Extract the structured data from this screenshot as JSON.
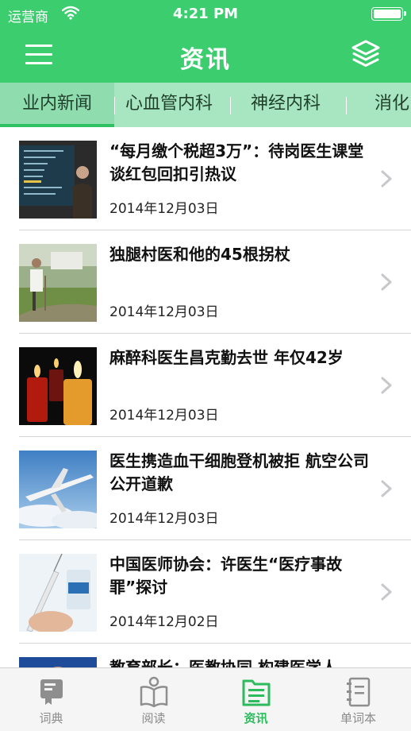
{
  "status_bar": {
    "carrier": "运营商",
    "time": "4:21 PM",
    "wifi_icon": "wifi-icon",
    "battery_icon": "battery-icon"
  },
  "nav": {
    "title": "资讯",
    "menu_icon": "menu-icon",
    "layers_icon": "layers-icon"
  },
  "colors": {
    "primary": "#3ccd6f",
    "tab_strip": "#a7e6c0",
    "active_tab_label": "#2dbb5d"
  },
  "category_tabs": [
    {
      "label": "业内新闻",
      "active": true
    },
    {
      "label": "心血管内科",
      "active": false
    },
    {
      "label": "神经内科",
      "active": false
    },
    {
      "label": "消化",
      "active": false
    }
  ],
  "news": [
    {
      "title": "“每月缴个税超3万”：待岗医生课堂谈红包回扣引热议",
      "date": "2014年12月03日",
      "thumb": "lecture-photo"
    },
    {
      "title": "独腿村医和他的45根拐杖",
      "date": "2014年12月03日",
      "thumb": "village-doctor-photo"
    },
    {
      "title": "麻醉科医生昌克勤去世 年仅42岁",
      "date": "2014年12月03日",
      "thumb": "candles-photo"
    },
    {
      "title": "医生携造血干细胞登机被拒 航空公司公开道歉",
      "date": "2014年12月03日",
      "thumb": "airplane-photo"
    },
    {
      "title": "中国医师协会：许医生“医疗事故罪”探讨",
      "date": "2014年12月02日",
      "thumb": "syringe-photo"
    },
    {
      "title": "教育部长：医教协同 构建医学人",
      "date": "",
      "thumb": "portrait-photo"
    }
  ],
  "bottom_tabs": [
    {
      "label": "词典",
      "icon": "dictionary-icon",
      "active": false
    },
    {
      "label": "阅读",
      "icon": "reading-icon",
      "active": false
    },
    {
      "label": "资讯",
      "icon": "news-folder-icon",
      "active": true
    },
    {
      "label": "单词本",
      "icon": "wordbook-icon",
      "active": false
    }
  ]
}
